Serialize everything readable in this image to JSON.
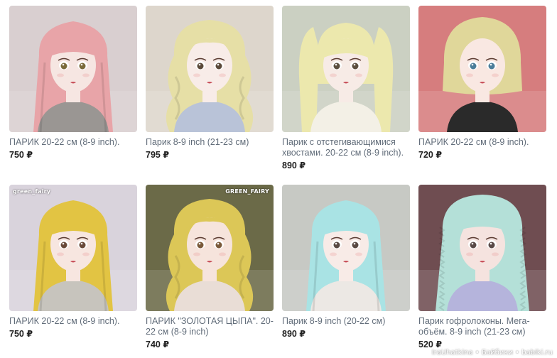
{
  "products": [
    {
      "title": "ПАРИК 20-22 см (8-9 inch).",
      "price": "750 ₽",
      "hair": "#e8a4a8",
      "bg": "#d9cfd0",
      "face": "#f6e6e2",
      "style": "straight",
      "cloth": "#9a9693"
    },
    {
      "title": "Парик 8-9 inch (21-23 см)",
      "price": "795 ₽",
      "hair": "#e6dfa6",
      "bg": "#ddd6cc",
      "face": "#f8ece8",
      "style": "wavy",
      "cloth": "#b9c3d8"
    },
    {
      "title": "Парик с отстегивающимися хвостами. 20-22 см (8-9 inch).",
      "price": "890 ₽",
      "hair": "#ece8ad",
      "bg": "#cbd0c2",
      "face": "#f7ebe6",
      "style": "tails",
      "cloth": "#f3f0e6"
    },
    {
      "title": "ПАРИК 20-22 см (8-9 inch).",
      "price": "720 ₽",
      "hair": "#e0d79a",
      "bg": "#d67d7e",
      "face": "#f9e8e2",
      "style": "bob",
      "cloth": "#2a2a2a"
    },
    {
      "title": "ПАРИК 20-22 см (8-9 inch).",
      "price": "750 ₽",
      "hair": "#e2c443",
      "bg": "#d9d3dc",
      "face": "#f7e6e0",
      "style": "straight",
      "cloth": "#c7c4bd",
      "watermark": "green_fairy"
    },
    {
      "title": "ПАРИК \"ЗОЛОТАЯ ЦЫПА\". 20-22 см (8-9 inch)",
      "price": "740 ₽",
      "hair": "#dcc757",
      "bg": "#6b6a48",
      "face": "#f6e4dc",
      "style": "wavy",
      "cloth": "#e9ddd6",
      "watermark": "GREEN_FAIRY"
    },
    {
      "title": "Парик 8-9 inch (20-22 см)",
      "price": "890 ₽",
      "hair": "#a9e3e4",
      "bg": "#c7c9c4",
      "face": "#f8ebe7",
      "style": "straight",
      "cloth": "#ece8e4"
    },
    {
      "title": "Парик гофролоконы. Мега-объём. 8-9 inch (21-23 см)",
      "price": "520 ₽",
      "hair": "#b4e0d8",
      "bg": "#6f4d51",
      "face": "#f5e3df",
      "style": "crimp",
      "cloth": "#b5b4dc"
    }
  ],
  "footer_watermark": "IraUhatkina • Бэйбики • babiki.ru"
}
